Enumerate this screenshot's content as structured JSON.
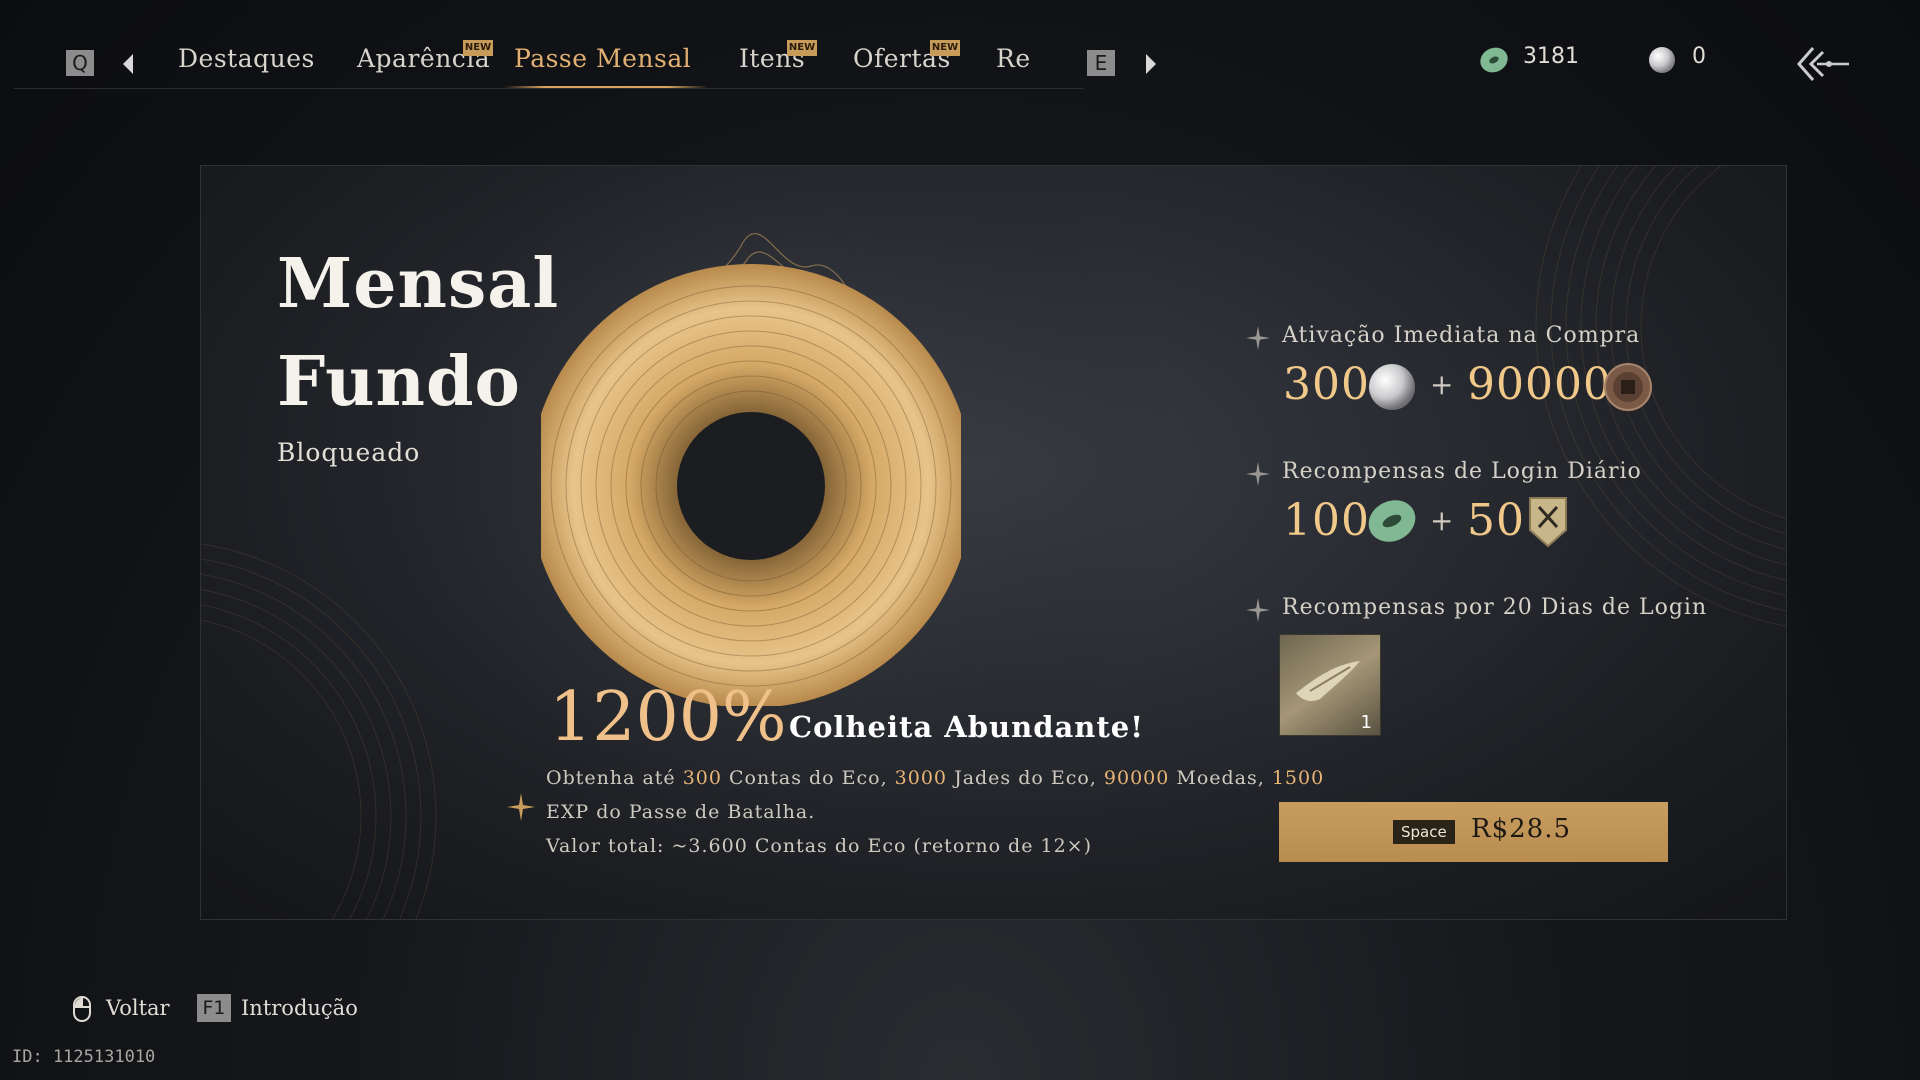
{
  "nav": {
    "left_key": "Q",
    "right_key": "E",
    "tabs": [
      {
        "label": "Destaques",
        "new": false
      },
      {
        "label": "Aparência",
        "new": true
      },
      {
        "label": "Passe Mensal",
        "new": false,
        "active": true
      },
      {
        "label": "Itens",
        "new": true
      },
      {
        "label": "Ofertas",
        "new": true
      },
      {
        "label": "Re",
        "new": false
      }
    ],
    "new_badge": "NEW"
  },
  "currency": {
    "jade": "3181",
    "pearl": "0"
  },
  "panel": {
    "title_line1": "Mensal",
    "title_line2": "Fundo",
    "status": "Bloqueado",
    "promo_percent": "1200%",
    "promo_tag": "Colheita Abundante!",
    "desc": {
      "p1": "Obtenha até ",
      "v1": "300",
      "p2": " Contas do Eco, ",
      "v2": "3000",
      "p3": " Jades do Eco, ",
      "v3": "90000",
      "p4": " Moedas, ",
      "v4": "1500",
      "line2": "EXP do Passe de Batalha.",
      "line3": "Valor total: ~3.600 Contas do Eco (retorno de 12×)"
    },
    "sections": {
      "instant": {
        "title": "Ativação Imediata na Compra",
        "value1": "300",
        "value2": "90000",
        "plus": "+"
      },
      "daily": {
        "title": "Recompensas de Login Diário",
        "value1": "100",
        "value2": "50",
        "plus": "+"
      },
      "login20": {
        "title": "Recompensas por 20 Dias de Login",
        "item_count": "1"
      }
    },
    "buy": {
      "key": "Space",
      "price": "R$28.5"
    }
  },
  "footer": {
    "back_label": "Voltar",
    "f1_key": "F1",
    "intro_label": "Introdução",
    "id_text": "ID: 1125131010"
  },
  "colors": {
    "accent_gold": "#e2b072",
    "button_gold": "#c79d5f",
    "jade_green": "#7fb892"
  }
}
